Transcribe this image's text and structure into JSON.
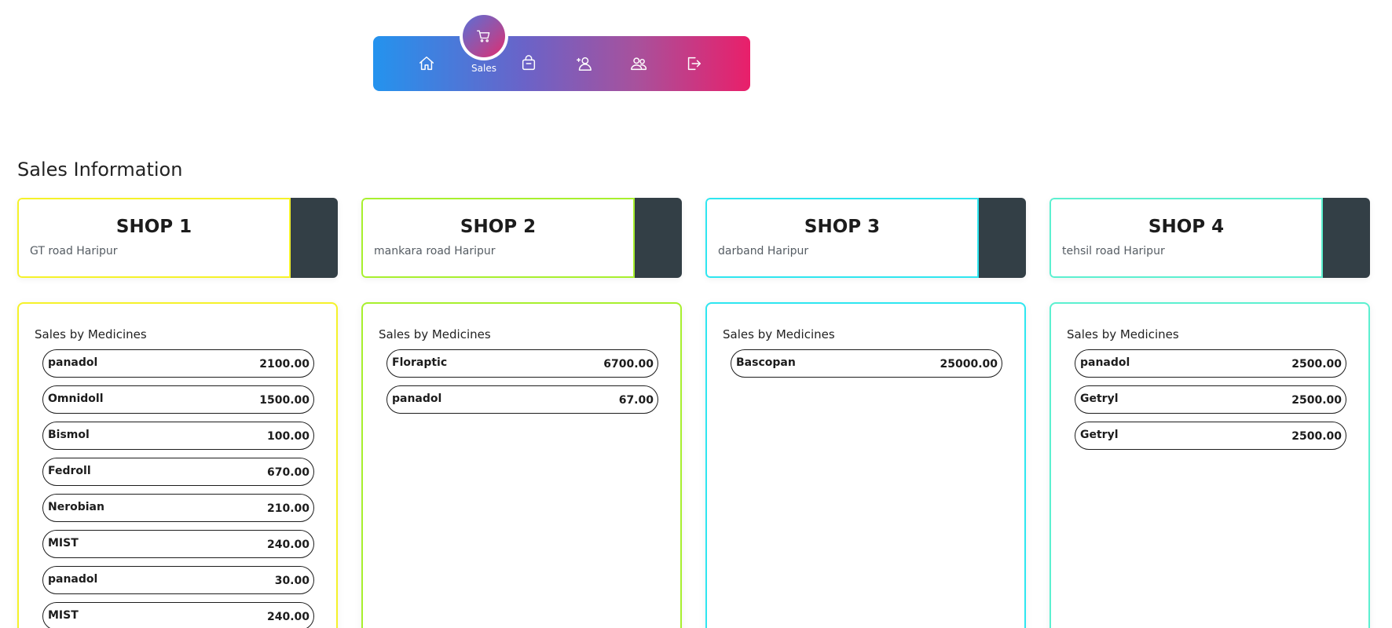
{
  "nav": {
    "active_label": "Sales",
    "items": [
      {
        "name": "home",
        "icon": "home-icon"
      },
      {
        "name": "sales",
        "icon": "cart-icon"
      },
      {
        "name": "inventory",
        "icon": "bag-icon"
      },
      {
        "name": "add-user",
        "icon": "user-plus-icon"
      },
      {
        "name": "users",
        "icon": "users-icon"
      },
      {
        "name": "logout",
        "icon": "logout-icon"
      }
    ],
    "gradient": [
      "#2493ee",
      "#e91f6a"
    ]
  },
  "page": {
    "title": "Sales Information"
  },
  "shops": [
    {
      "name": "SHOP 1",
      "address": "GT road Haripur",
      "accent": "#f5f22a",
      "panel_title": "Sales by Medicines",
      "sales": [
        {
          "medicine": "panadol",
          "amount": "2100.00"
        },
        {
          "medicine": "Omnidoll",
          "amount": "1500.00"
        },
        {
          "medicine": "Bismol",
          "amount": "100.00"
        },
        {
          "medicine": "Fedroll",
          "amount": "670.00"
        },
        {
          "medicine": "Nerobian",
          "amount": "210.00"
        },
        {
          "medicine": "MIST",
          "amount": "240.00"
        },
        {
          "medicine": "panadol",
          "amount": "30.00"
        },
        {
          "medicine": "MIST",
          "amount": "240.00"
        }
      ]
    },
    {
      "name": "SHOP 2",
      "address": "mankara road Haripur",
      "accent": "#a8f02e",
      "panel_title": "Sales by Medicines",
      "sales": [
        {
          "medicine": "Floraptic",
          "amount": "6700.00"
        },
        {
          "medicine": "panadol",
          "amount": "67.00"
        }
      ]
    },
    {
      "name": "SHOP 3",
      "address": "darband Haripur",
      "accent": "#2ee6f0",
      "panel_title": "Sales by Medicines",
      "sales": [
        {
          "medicine": "Bascopan",
          "amount": "25000.00"
        }
      ]
    },
    {
      "name": "SHOP 4",
      "address": "tehsil road Haripur",
      "accent": "#5cf0d0",
      "panel_title": "Sales by Medicines",
      "sales": [
        {
          "medicine": "panadol",
          "amount": "2500.00"
        },
        {
          "medicine": "Getryl",
          "amount": "2500.00"
        },
        {
          "medicine": "Getryl",
          "amount": "2500.00"
        }
      ]
    }
  ]
}
